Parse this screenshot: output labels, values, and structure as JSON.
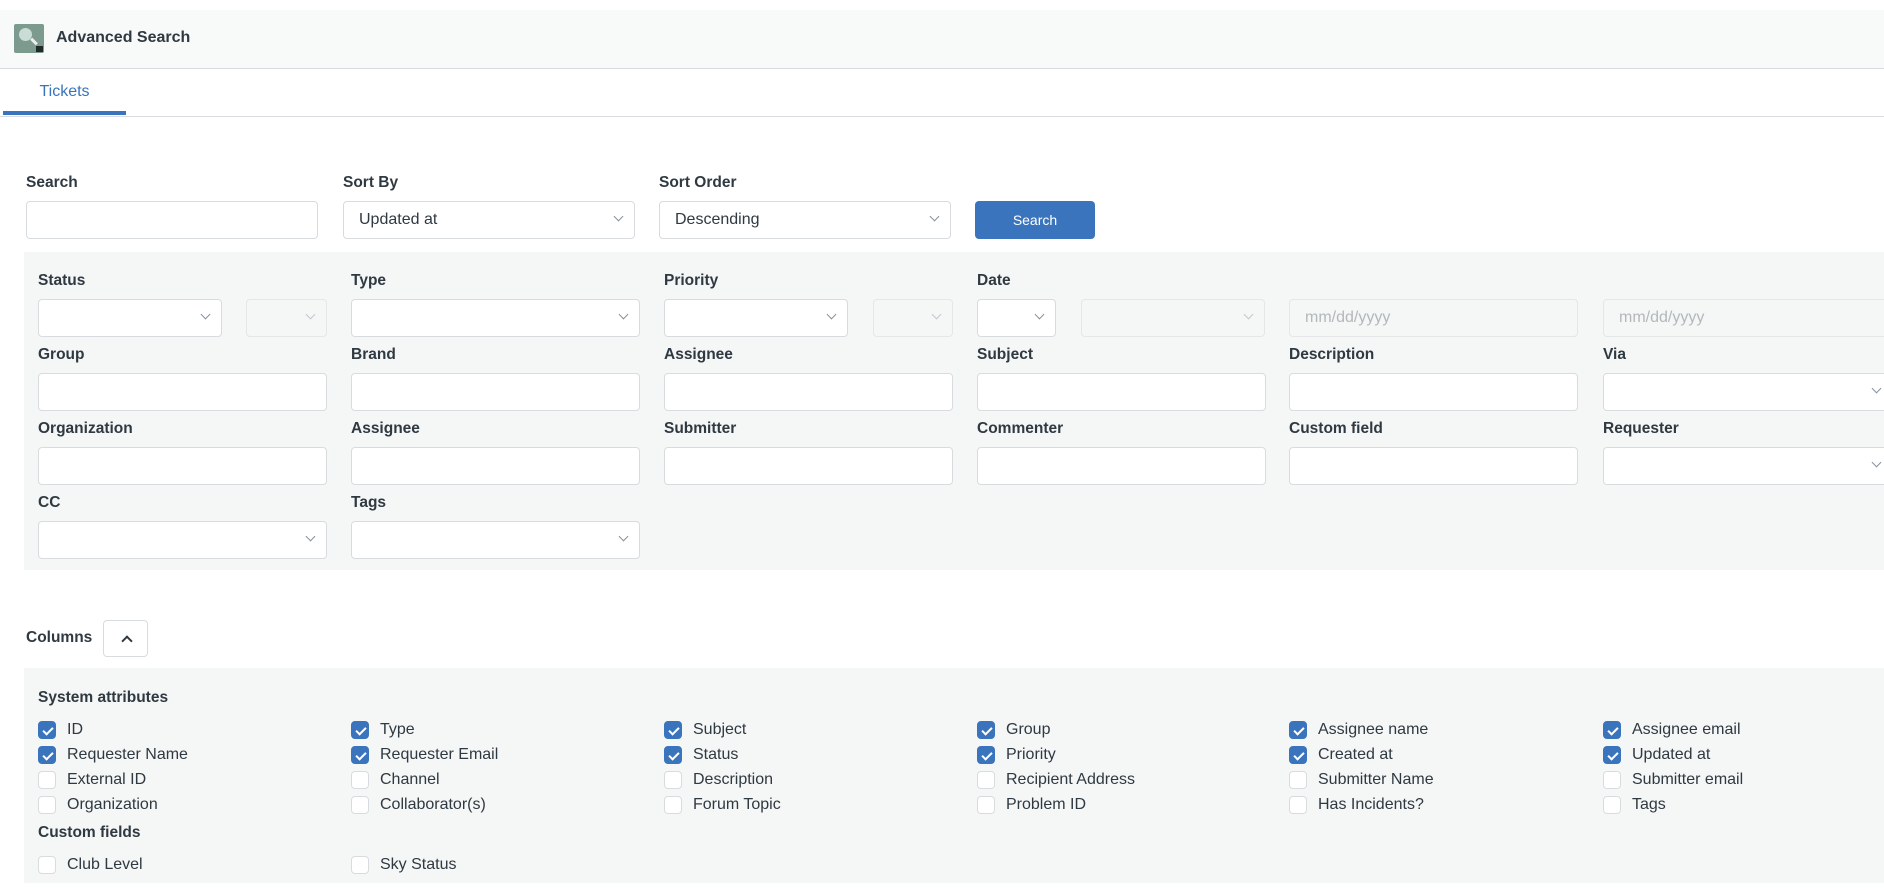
{
  "header": {
    "title": "Advanced Search",
    "icon": "magnifier-lock-icon"
  },
  "tabs": [
    {
      "label": "Tickets",
      "active": true
    }
  ],
  "search_row": {
    "search_label": "Search",
    "search_value": "",
    "sort_by_label": "Sort By",
    "sort_by_value": "Updated at",
    "sort_order_label": "Sort Order",
    "sort_order_value": "Descending",
    "search_button": "Search"
  },
  "filters": {
    "row1": {
      "status_label": "Status",
      "type_label": "Type",
      "priority_label": "Priority",
      "date_label": "Date",
      "date_from_placeholder": "mm/dd/yyyy",
      "date_to_placeholder": "mm/dd/yyyy"
    },
    "fields": [
      {
        "label": "Group",
        "kind": "input"
      },
      {
        "label": "Brand",
        "kind": "input"
      },
      {
        "label": "Assignee",
        "kind": "input"
      },
      {
        "label": "Subject",
        "kind": "input"
      },
      {
        "label": "Description",
        "kind": "input"
      },
      {
        "label": "Via",
        "kind": "select"
      },
      {
        "label": "Organization",
        "kind": "input"
      },
      {
        "label": "Assignee",
        "kind": "input"
      },
      {
        "label": "Submitter",
        "kind": "input"
      },
      {
        "label": "Commenter",
        "kind": "input"
      },
      {
        "label": "Custom field",
        "kind": "input"
      },
      {
        "label": "Requester",
        "kind": "select"
      },
      {
        "label": "CC",
        "kind": "select"
      },
      {
        "label": "Tags",
        "kind": "select"
      }
    ]
  },
  "columns": {
    "label": "Columns",
    "system_heading": "System attributes",
    "system": [
      {
        "label": "ID",
        "checked": true
      },
      {
        "label": "Type",
        "checked": true
      },
      {
        "label": "Subject",
        "checked": true
      },
      {
        "label": "Group",
        "checked": true
      },
      {
        "label": "Assignee name",
        "checked": true
      },
      {
        "label": "Assignee email",
        "checked": true
      },
      {
        "label": "Requester Name",
        "checked": true
      },
      {
        "label": "Requester Email",
        "checked": true
      },
      {
        "label": "Status",
        "checked": true
      },
      {
        "label": "Priority",
        "checked": true
      },
      {
        "label": "Created at",
        "checked": true
      },
      {
        "label": "Updated at",
        "checked": true
      },
      {
        "label": "External ID",
        "checked": false
      },
      {
        "label": "Channel",
        "checked": false
      },
      {
        "label": "Description",
        "checked": false
      },
      {
        "label": "Recipient Address",
        "checked": false
      },
      {
        "label": "Submitter Name",
        "checked": false
      },
      {
        "label": "Submitter email",
        "checked": false
      },
      {
        "label": "Organization",
        "checked": false
      },
      {
        "label": "Collaborator(s)",
        "checked": false
      },
      {
        "label": "Forum Topic",
        "checked": false
      },
      {
        "label": "Problem ID",
        "checked": false
      },
      {
        "label": "Has Incidents?",
        "checked": false
      },
      {
        "label": "Tags",
        "checked": false
      }
    ],
    "custom_heading": "Custom fields",
    "custom": [
      {
        "label": "Club Level",
        "checked": false
      },
      {
        "label": "Sky Status",
        "checked": false
      }
    ]
  },
  "colors": {
    "accent": "#3a74bd",
    "panel": "#f5f6f6",
    "text": "#2f3941"
  }
}
